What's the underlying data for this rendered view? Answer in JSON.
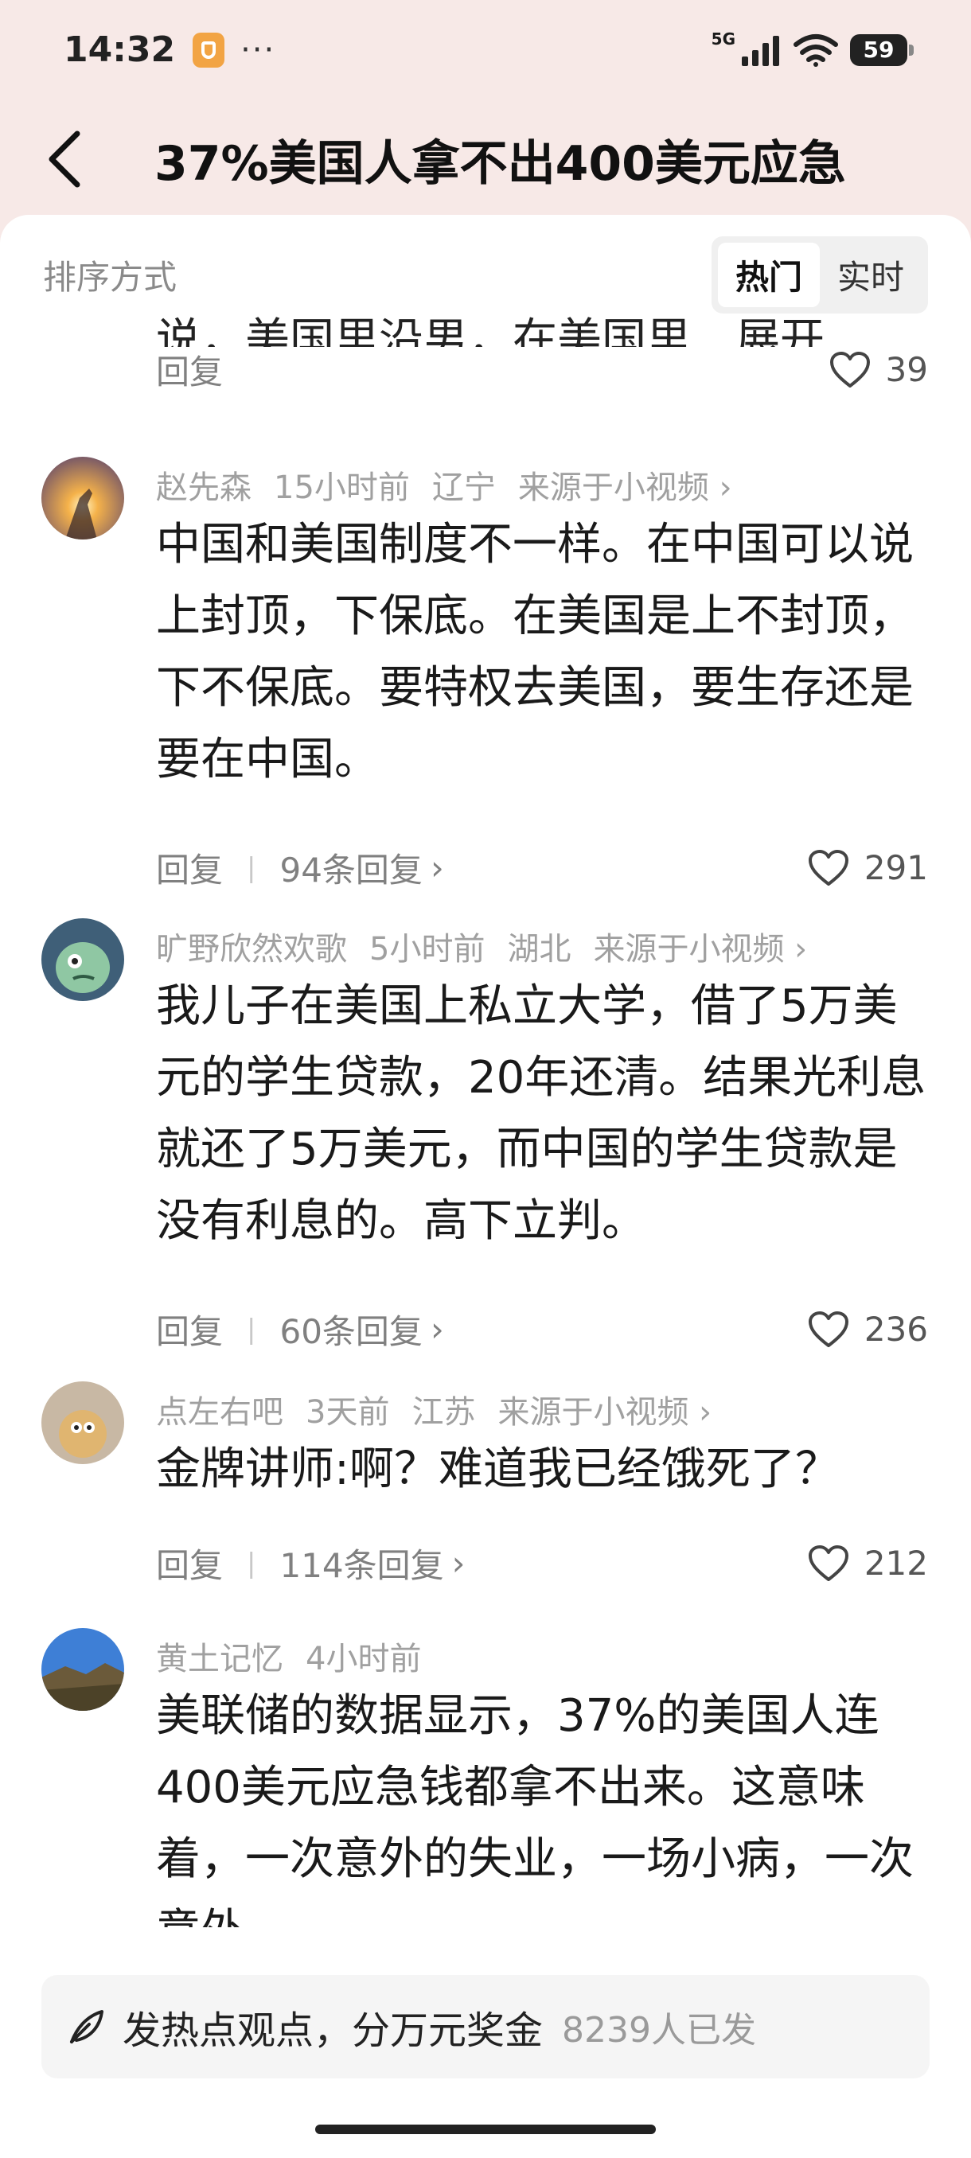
{
  "status": {
    "time": "14:32",
    "dots": "···",
    "network": "5G",
    "battery": "59"
  },
  "header": {
    "title": "37%美国人拿不出400美元应急"
  },
  "sort": {
    "label": "排序方式",
    "options": [
      "热门",
      "实时"
    ]
  },
  "top_partial": {
    "text": "说，美国里沿男，在美国里…展开",
    "reply": "回复",
    "likes": "39"
  },
  "comments": [
    {
      "user": "赵先森",
      "time": "15小时前",
      "region": "辽宁",
      "source": "来源于小视频",
      "text": "中国和美国制度不一样。在中国可以说上封顶，下保底。在美国是上不封顶，下不保底。要特权去美国，要生存还是要在中国。",
      "reply": "回复",
      "reply_count": "94条回复",
      "likes": "291"
    },
    {
      "user": "旷野欣然欢歌",
      "time": "5小时前",
      "region": "湖北",
      "source": "来源于小视频",
      "text": "我儿子在美国上私立大学，借了5万美元的学生贷款，20年还清。结果光利息就还了5万美元，而中国的学生贷款是没有利息的。高下立判。",
      "reply": "回复",
      "reply_count": "60条回复",
      "likes": "236"
    },
    {
      "user": "点左右吧",
      "time": "3天前",
      "region": "江苏",
      "source": "来源于小视频",
      "text": "金牌讲师:啊？难道我已经饿死了？",
      "reply": "回复",
      "reply_count": "114条回复",
      "likes": "212"
    },
    {
      "user": "黄土记忆",
      "time": "4小时前",
      "text": "美联储的数据显示，37%的美国人连400美元应急钱都拿不出来。这意味着，一次意外的失业，一场小病，一次意外……"
    }
  ],
  "compose": {
    "prompt": "发热点观点，分万元奖金",
    "count": "8239人已发"
  }
}
